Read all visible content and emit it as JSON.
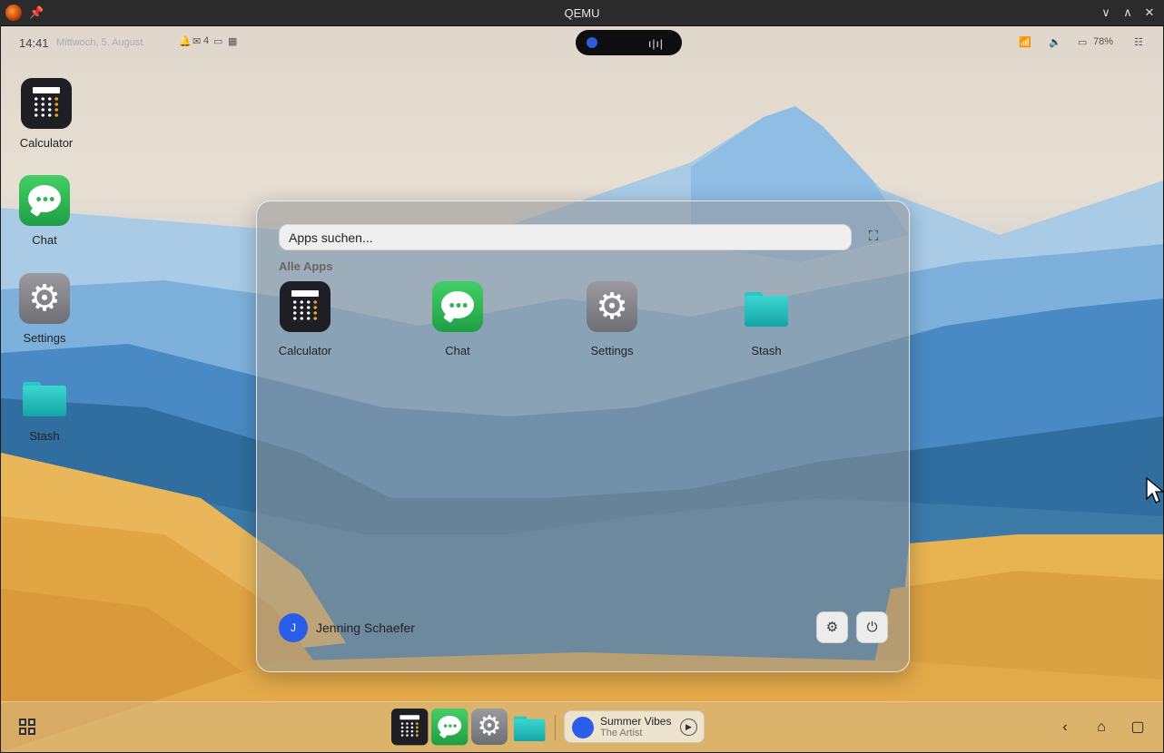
{
  "window": {
    "title": "QEMU",
    "controls": [
      "minimize",
      "maximize",
      "close"
    ]
  },
  "status": {
    "time": "14:41",
    "date": "Mittwoch, 5. August",
    "notif_mail_count": "4",
    "battery": "78%",
    "colors": {
      "island": "#0e0e10",
      "island_dot": "#2f5bd8"
    }
  },
  "desktop_icons": [
    {
      "label": "Calculator",
      "icon": "calculator-icon"
    },
    {
      "label": "Chat",
      "icon": "chat-icon"
    },
    {
      "label": "Settings",
      "icon": "settings-gear-icon"
    },
    {
      "label": "Stash",
      "icon": "folder-icon"
    }
  ],
  "launcher": {
    "search_placeholder": "Apps suchen...",
    "section_label": "Alle Apps",
    "apps": [
      {
        "label": "Calculator",
        "icon": "calculator-icon"
      },
      {
        "label": "Chat",
        "icon": "chat-icon"
      },
      {
        "label": "Settings",
        "icon": "settings-gear-icon"
      },
      {
        "label": "Stash",
        "icon": "folder-icon"
      }
    ],
    "user": {
      "initial": "J",
      "name": "Jenning Schaefer",
      "avatar_color": "#2a5ee8"
    }
  },
  "taskbar": {
    "dock": [
      "calculator-icon",
      "chat-icon",
      "settings-gear-icon",
      "folder-icon"
    ],
    "media": {
      "title": "Summer Vibes",
      "artist": "The Artist"
    }
  }
}
